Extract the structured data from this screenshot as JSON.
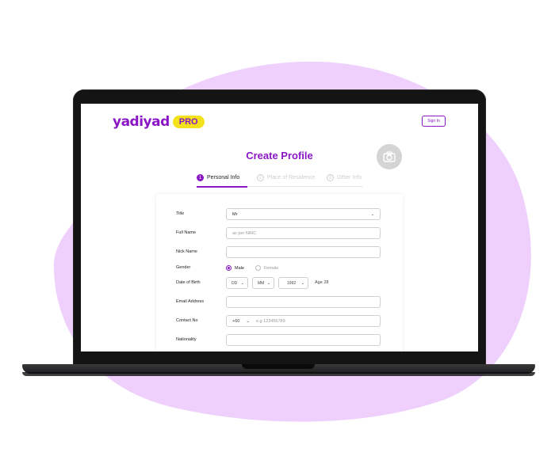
{
  "brand": {
    "name": "yadiyad",
    "badge": "PRO",
    "color": "#8a16c6",
    "badge_color": "#f3e21a"
  },
  "header": {
    "sign_in": "Sign In"
  },
  "page": {
    "title": "Create Profile"
  },
  "steps": [
    {
      "num": "1",
      "label": "Personal Info",
      "state": "active"
    },
    {
      "num": "2",
      "label": "Place of Residence",
      "state": "inactive"
    },
    {
      "num": "3",
      "label": "Other Info",
      "state": "inactive"
    }
  ],
  "form": {
    "title_label": "Title",
    "title_value": "Mr",
    "full_name_label": "Full Name",
    "full_name_placeholder": "as per NRIC",
    "nick_name_label": "Nick Name",
    "gender_label": "Gender",
    "gender_options": [
      "Male",
      "Female"
    ],
    "gender_selected": "Male",
    "dob_label": "Date of Birth",
    "dob_day": "DD",
    "dob_month": "MM",
    "dob_year": "1992",
    "age_text": "Age 28",
    "email_label": "Email Address",
    "contact_label": "Contact No",
    "contact_code": "+60",
    "contact_placeholder": "e.g 123456789",
    "nationality_label": "Nationality"
  }
}
